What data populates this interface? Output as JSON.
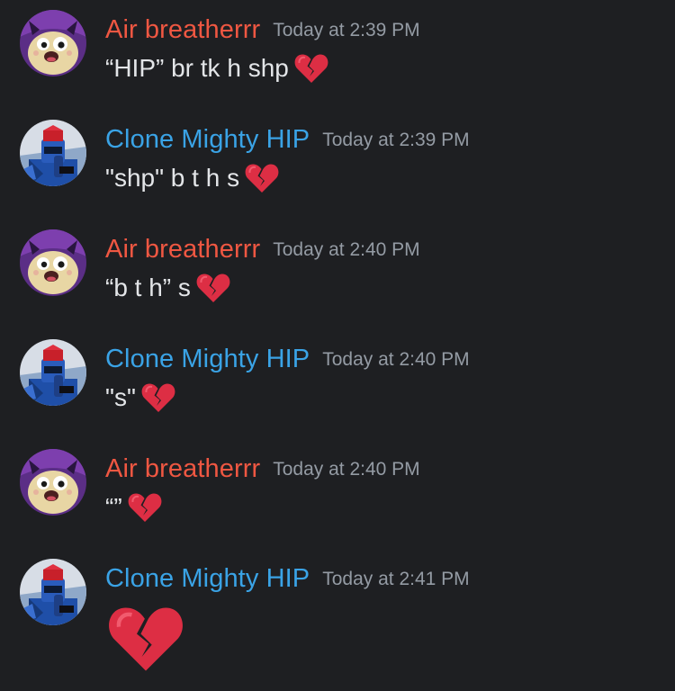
{
  "messages": [
    {
      "author": "Air breatherrr",
      "avatar": "tamagotchi-creature-avatar",
      "time": "Today at 2:39 PM",
      "text": "“HIP” br tk h shp",
      "emoji": "broken-heart-icon"
    },
    {
      "author": "Clone Mighty HIP",
      "avatar": "blue-robot-avatar",
      "time": "Today at 2:39 PM",
      "text": "\"shp\" b t h s",
      "emoji": "broken-heart-icon"
    },
    {
      "author": "Air breatherrr",
      "avatar": "tamagotchi-creature-avatar",
      "time": "Today at 2:40 PM",
      "text": "“b t h” s",
      "emoji": "broken-heart-icon"
    },
    {
      "author": "Clone Mighty HIP",
      "avatar": "blue-robot-avatar",
      "time": "Today at 2:40 PM",
      "text": "\"s\"",
      "emoji": "broken-heart-icon"
    },
    {
      "author": "Air breatherrr",
      "avatar": "tamagotchi-creature-avatar",
      "time": "Today at 2:40 PM",
      "text": "“”",
      "emoji": "broken-heart-icon"
    },
    {
      "author": "Clone Mighty HIP",
      "avatar": "blue-robot-avatar",
      "time": "Today at 2:41 PM",
      "text": "",
      "emoji": "broken-heart-icon"
    }
  ],
  "colors": {
    "background": "#1e1f22",
    "air_name": "#ef5742",
    "clone_name": "#3aa3e6",
    "timestamp": "#949ba4",
    "message_text": "#e3e5e8",
    "heart": "#dd2e44"
  }
}
